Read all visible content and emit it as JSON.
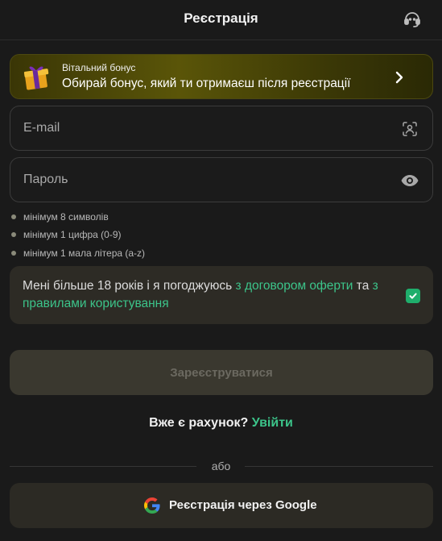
{
  "header": {
    "title": "Реєстрація",
    "support_icon": "headset-icon"
  },
  "bonus": {
    "label": "Вітальний бонус",
    "text": "Обирай бонус, який ти отримаєш після реєстрації",
    "icon": "gift-icon"
  },
  "form": {
    "email": {
      "placeholder": "E-mail",
      "value": "",
      "icon": "contact-scan-icon"
    },
    "password": {
      "placeholder": "Пароль",
      "value": "",
      "icon": "eye-icon"
    }
  },
  "password_rules": [
    "мінімум 8 символів",
    "мінімум 1 цифра (0-9)",
    "мінімум 1 мала літера (a-z)"
  ],
  "agreement": {
    "text_1": "Мені більше 18 років і я погоджуюсь ",
    "link_1": "з договором оферти",
    "text_2": " та ",
    "link_2": "з правилами користування",
    "checked": true
  },
  "register_button": "Зареєструватися",
  "login": {
    "question": "Вже є рахунок?",
    "link": "Увійти"
  },
  "divider_text": "або",
  "google_button": "Реєстрація через Google",
  "colors": {
    "background": "#1a1a1a",
    "accent_green": "#3cc48a",
    "checkbox_green": "#1fae6c",
    "bonus_banner": "#5a5508"
  }
}
